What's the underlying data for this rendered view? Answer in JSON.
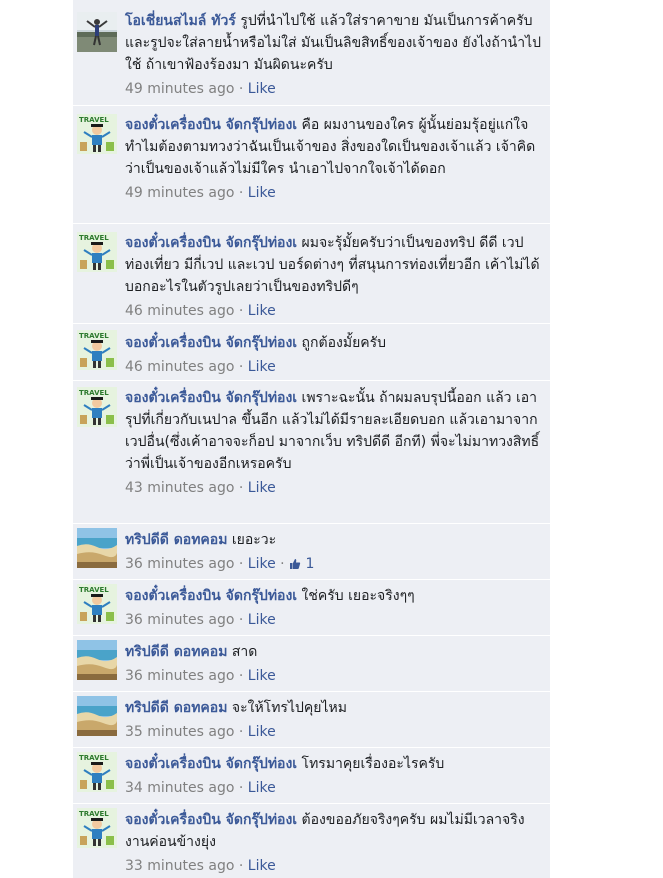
{
  "like_label": "Like",
  "comments": [
    {
      "author": "โอเชี่ยนสไมล์ ทัวร์",
      "text": "รูปที่นำไปใช้ แล้วใส่ราคาขาย มันเป็นการค้าครับ และรูปจะใส่ลายน้ำหรือไม่ใส่ มันเป็นลิขสิทธิ์ของเจ้าของ ยังไงถ้านำไปใช้ ถ้าเขาฟ้องร้องมา มันผิดนะครับ",
      "time": "49 minutes ago",
      "avatar": "person-photo"
    },
    {
      "author": "จองตั๋วเครื่องบิน จัดกรุ๊ปท่องเ",
      "text": "คือ ผมงานของใคร ผู้นั้นย่อมรุ้อยู่แก่ใจ ทำไมต้องตามทวงว่าฉันเป็นเจ้าของ สิ่งของใดเป็นของเจ้าแล้ว เจ้าคิดว่าเป็นของเจ้าแล้วไม่มีใคร นำเอาไปจากใจเจ้าได้ดอก",
      "time": "49 minutes ago",
      "avatar": "travel-cartoon"
    },
    {
      "author": "จองตั๋วเครื่องบิน จัดกรุ๊ปท่องเ",
      "text": "ผมจะรุ้มั้ยครับว่าเป็นของทริป ดีดี เวป ท่องเที่ยว มีกี่เวป และเวป บอร์ดต่างๆ ที่สนุนการท่องเที่ยวอีก เค้าไม่ได้บอกอะไรในตัวรูปเลยว่าเป็นของทริปดีๆ",
      "time": "46 minutes ago",
      "avatar": "travel-cartoon"
    },
    {
      "author": "จองตั๋วเครื่องบิน จัดกรุ๊ปท่องเ",
      "text": "ถูกต้องมั้ยครับ",
      "time": "46 minutes ago",
      "avatar": "travel-cartoon"
    },
    {
      "author": "จองตั๋วเครื่องบิน จัดกรุ๊ปท่องเ",
      "text": "เพราะฉะนั้น ถ้าผมลบรุปนี้ออก แล้ว เอารุปที่เกี่ยวกับเนปาล ขึ้นอีก แล้วไม่ได้มีรายละเอียดบอก แล้วเอามาจากเวปอื่น(ซึ่งเค้าอาจจะก็อป มาจากเว็บ ทริปดีดี อีกที) พี่จะไม่มาทวงสิทธิ์ ว่าพี่เป็นเจ้าของอีกเหรอครับ",
      "time": "43 minutes ago",
      "avatar": "travel-cartoon"
    },
    {
      "author": "ทริปดีดี ดอทคอม",
      "text": "เยอะวะ",
      "time": "36 minutes ago",
      "avatar": "beach-photo",
      "likes": "1"
    },
    {
      "author": "จองตั๋วเครื่องบิน จัดกรุ๊ปท่องเ",
      "text": "ใช่ครับ เยอะจริงๆๆ",
      "time": "36 minutes ago",
      "avatar": "travel-cartoon"
    },
    {
      "author": "ทริปดีดี ดอทคอม",
      "text": "สาด",
      "time": "36 minutes ago",
      "avatar": "beach-photo"
    },
    {
      "author": "ทริปดีดี ดอทคอม",
      "text": "จะให้โทรไปคุยไหม",
      "time": "35 minutes ago",
      "avatar": "beach-photo"
    },
    {
      "author": "จองตั๋วเครื่องบิน จัดกรุ๊ปท่องเ",
      "text": "โทรมาคุยเรื่องอะไรครับ",
      "time": "34 minutes ago",
      "avatar": "travel-cartoon"
    },
    {
      "author": "จองตั๋วเครื่องบิน จัดกรุ๊ปท่องเ",
      "text": "ต้องขออภัยจริงๆครับ ผมไม่มีเวลาจริง งานค่อนข้างยุ่ง",
      "time": "33 minutes ago",
      "avatar": "travel-cartoon"
    }
  ]
}
